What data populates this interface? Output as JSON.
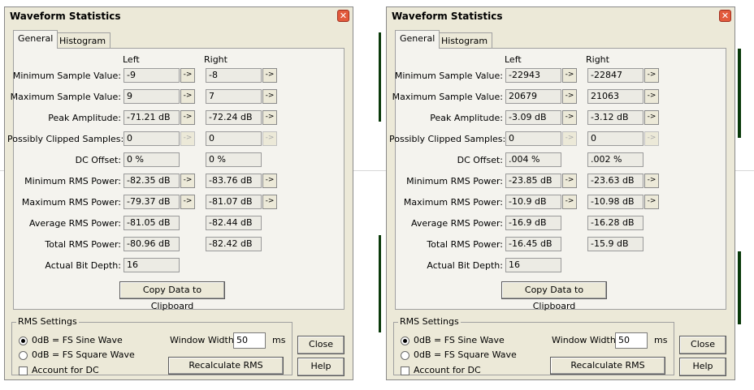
{
  "colors": {
    "dialog_bg": "#ece9d8",
    "close_x": "#e25a3c",
    "waveform": "#0a3a0a"
  },
  "dialogs": [
    {
      "title": "Waveform Statistics",
      "tabs": [
        "General",
        "Histogram"
      ],
      "col_left": "Left",
      "col_right": "Right",
      "rows": [
        {
          "label": "Minimum Sample Value:",
          "left": "-9",
          "right": "-8",
          "arrows": true,
          "disabled": false
        },
        {
          "label": "Maximum Sample Value:",
          "left": "9",
          "right": "7",
          "arrows": true,
          "disabled": false
        },
        {
          "label": "Peak Amplitude:",
          "left": "-71.21 dB",
          "right": "-72.24 dB",
          "arrows": true,
          "disabled": false
        },
        {
          "label": "Possibly Clipped Samples:",
          "left": "0",
          "right": "0",
          "arrows": true,
          "disabled": true
        },
        {
          "label": "DC Offset:",
          "left": "0 %",
          "right": "0 %",
          "arrows": false
        },
        {
          "label": "Minimum RMS Power:",
          "left": "-82.35 dB",
          "right": "-83.76 dB",
          "arrows": true,
          "disabled": false
        },
        {
          "label": "Maximum RMS Power:",
          "left": "-79.37 dB",
          "right": "-81.07 dB",
          "arrows": true,
          "disabled": false
        },
        {
          "label": "Average RMS Power:",
          "left": "-81.05 dB",
          "right": "-82.44 dB",
          "arrows": false
        },
        {
          "label": "Total RMS Power:",
          "left": "-80.96 dB",
          "right": "-82.42 dB",
          "arrows": false
        },
        {
          "label": "Actual Bit Depth:",
          "left": "16",
          "right": null,
          "arrows": false
        }
      ],
      "arrow_glyph": "->",
      "copy_button": "Copy Data to Clipboard",
      "rms": {
        "group_label": "RMS Settings",
        "sine": "0dB = FS Sine Wave",
        "square": "0dB = FS Square Wave",
        "dc": "Account for DC",
        "window_label": "Window Width:",
        "window_value": "50",
        "window_unit": "ms",
        "recalc": "Recalculate RMS"
      },
      "close": "Close",
      "help": "Help"
    },
    {
      "title": "Waveform Statistics",
      "tabs": [
        "General",
        "Histogram"
      ],
      "col_left": "Left",
      "col_right": "Right",
      "rows": [
        {
          "label": "Minimum Sample Value:",
          "left": "-22943",
          "right": "-22847",
          "arrows": true,
          "disabled": false
        },
        {
          "label": "Maximum Sample Value:",
          "left": "20679",
          "right": "21063",
          "arrows": true,
          "disabled": false
        },
        {
          "label": "Peak Amplitude:",
          "left": "-3.09 dB",
          "right": "-3.12 dB",
          "arrows": true,
          "disabled": false
        },
        {
          "label": "Possibly Clipped Samples:",
          "left": "0",
          "right": "0",
          "arrows": true,
          "disabled": true
        },
        {
          "label": "DC Offset:",
          "left": ".004 %",
          "right": ".002 %",
          "arrows": false
        },
        {
          "label": "Minimum RMS Power:",
          "left": "-23.85 dB",
          "right": "-23.63 dB",
          "arrows": true,
          "disabled": false
        },
        {
          "label": "Maximum RMS Power:",
          "left": "-10.9 dB",
          "right": "-10.98 dB",
          "arrows": true,
          "disabled": false
        },
        {
          "label": "Average RMS Power:",
          "left": "-16.9 dB",
          "right": "-16.28 dB",
          "arrows": false
        },
        {
          "label": "Total RMS Power:",
          "left": "-16.45 dB",
          "right": "-15.9 dB",
          "arrows": false
        },
        {
          "label": "Actual Bit Depth:",
          "left": "16",
          "right": null,
          "arrows": false
        }
      ],
      "arrow_glyph": "->",
      "copy_button": "Copy Data to Clipboard",
      "rms": {
        "group_label": "RMS Settings",
        "sine": "0dB = FS Sine Wave",
        "square": "0dB = FS Square Wave",
        "dc": "Account for DC",
        "window_label": "Window Width:",
        "window_value": "50",
        "window_unit": "ms",
        "recalc": "Recalculate RMS"
      },
      "close": "Close",
      "help": "Help"
    }
  ]
}
